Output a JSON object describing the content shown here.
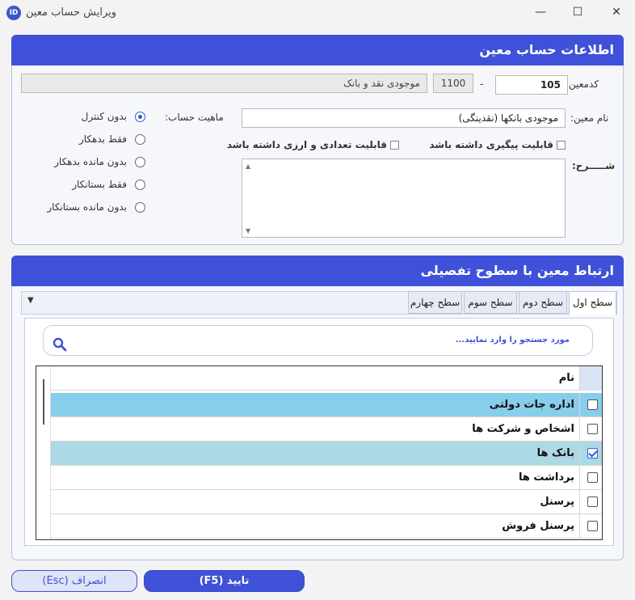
{
  "window": {
    "title": "ویرایش حساب معین",
    "minimize": "—",
    "maximize": "☐",
    "close": "✕",
    "app_icon": "ID"
  },
  "info_panel": {
    "header": "اطلاعات حساب معین",
    "code_label": "کدمعین:",
    "code_value": "105",
    "dash": "-",
    "parent_code": "1100",
    "parent_name": "موجودی نقد و بانک",
    "name_label": "نام معین:",
    "name_value": "موجودی بانکها (نقدینگی)",
    "nature_label": "ماهیت حساب:",
    "nature_options": [
      "بدون کنترل",
      "فقط بدهکار",
      "بدون مانده بدهکار",
      "فقط بستانکار",
      "بدون مانده بستانکار"
    ],
    "tracking_label": "قابلیت پیگیری داشته باشد",
    "currency_label": "قابلیت تعدادی و ارزی داشته باشد",
    "description_label": "شـــــرح:"
  },
  "link_panel": {
    "header": "ارتباط معین با سطوح تفصیلی",
    "tabs": [
      "سطح اول",
      "سطح دوم",
      "سطح سوم",
      "سطح چهارم"
    ],
    "dropdown_glyph": "▼",
    "search_placeholder": "مورد جستجو را وارد نمایید...",
    "column_name": "نام",
    "rows": [
      "اداره جات دولتی",
      "اشخاص و شرکت ها",
      "بانک ها",
      "برداشت ها",
      "پرسنل",
      "پرسنل فروش"
    ]
  },
  "buttons": {
    "confirm": "تایید (F5)",
    "cancel": "انصراف (Esc)"
  },
  "colors": {
    "accent": "#3f51d8",
    "row_highlight": "#87ceeb",
    "row_selected": "#add8e6"
  }
}
